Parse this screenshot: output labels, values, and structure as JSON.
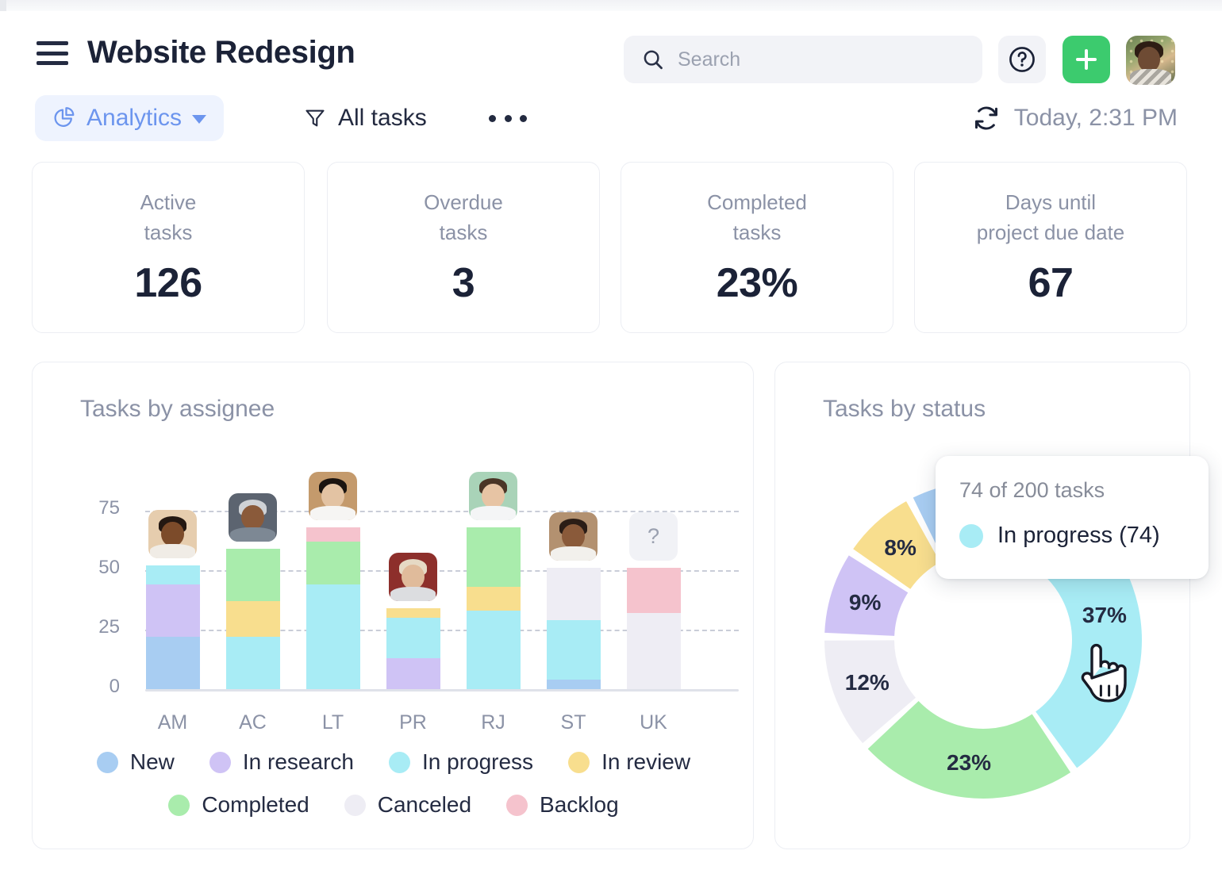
{
  "window": {
    "title": "Website Redesign"
  },
  "header": {
    "menu_icon": "hamburger-icon",
    "title": "Website Redesign",
    "search": {
      "placeholder": "Search",
      "value": "",
      "icon": "search-icon"
    },
    "help_icon": "question-circle-icon",
    "add_icon": "plus-icon",
    "avatar": "user-avatar"
  },
  "toolbar": {
    "view_label": "Analytics",
    "view_icon": "pie-chart-icon",
    "chevron_icon": "chevron-down-icon",
    "filter_label": "All tasks",
    "filter_icon": "funnel-icon",
    "more_icon": "ellipsis-icon",
    "refresh_icon": "refresh-icon",
    "refresh_label": "Today, 2:31 PM"
  },
  "stats": [
    {
      "label": "Active\ntasks",
      "value": "126"
    },
    {
      "label": "Overdue\ntasks",
      "value": "3"
    },
    {
      "label": "Completed\ntasks",
      "value": "23%"
    },
    {
      "label": "Days until\nproject due date",
      "value": "67"
    }
  ],
  "assignee_panel": {
    "title": "Tasks by assignee",
    "avatars": [
      {
        "initials": "AM",
        "known": true
      },
      {
        "initials": "AC",
        "known": true
      },
      {
        "initials": "LT",
        "known": true
      },
      {
        "initials": "PR",
        "known": true
      },
      {
        "initials": "RJ",
        "known": true
      },
      {
        "initials": "ST",
        "known": true
      },
      {
        "initials": "UK",
        "known": false,
        "placeholder": "?"
      }
    ]
  },
  "status_panel": {
    "title": "Tasks by status",
    "tooltip": {
      "headline": "74 of 200 tasks",
      "series_label": "In progress (74)",
      "series_color": "#a8ecf5"
    },
    "cursor_icon": "pointer-hand-cursor"
  },
  "statuses": [
    {
      "name": "New",
      "color": "#a8cdf2"
    },
    {
      "name": "In research",
      "color": "#cfc3f5"
    },
    {
      "name": "In progress",
      "color": "#a8ecf5"
    },
    {
      "name": "In review",
      "color": "#f8de8e"
    },
    {
      "name": "Completed",
      "color": "#a9ecac"
    },
    {
      "name": "Canceled",
      "color": "#eeedf4"
    },
    {
      "name": "Backlog",
      "color": "#f5c3cd"
    }
  ],
  "chart_data": [
    {
      "type": "bar",
      "stacked": true,
      "title": "Tasks by assignee",
      "xlabel": "",
      "ylabel": "",
      "ylim": [
        0,
        80
      ],
      "yticks": [
        0,
        25,
        50,
        75
      ],
      "grid": true,
      "legend_position": "bottom",
      "categories": [
        "AM",
        "AC",
        "LT",
        "PR",
        "RJ",
        "ST",
        "UK"
      ],
      "series": [
        {
          "name": "New",
          "color": "#a8cdf2",
          "values": [
            22,
            0,
            0,
            0,
            0,
            4,
            0
          ]
        },
        {
          "name": "In research",
          "color": "#cfc3f5",
          "values": [
            22,
            0,
            0,
            13,
            0,
            0,
            0
          ]
        },
        {
          "name": "In progress",
          "color": "#a8ecf5",
          "values": [
            8,
            22,
            44,
            17,
            33,
            25,
            0
          ]
        },
        {
          "name": "In review",
          "color": "#f8de8e",
          "values": [
            0,
            15,
            0,
            4,
            10,
            0,
            0
          ]
        },
        {
          "name": "Completed",
          "color": "#a9ecac",
          "values": [
            0,
            22,
            18,
            0,
            25,
            0,
            0
          ]
        },
        {
          "name": "Canceled",
          "color": "#eeedf4",
          "values": [
            0,
            0,
            0,
            0,
            0,
            22,
            32
          ]
        },
        {
          "name": "Backlog",
          "color": "#f5c3cd",
          "values": [
            0,
            0,
            6,
            0,
            0,
            0,
            19
          ]
        }
      ],
      "totals": [
        52,
        59,
        68,
        34,
        68,
        51,
        51
      ]
    },
    {
      "type": "pie",
      "donut": true,
      "title": "Tasks by status",
      "total_tasks": 200,
      "labels": [
        "In progress",
        "Completed",
        "Canceled",
        "In research",
        "In review",
        "New"
      ],
      "values": [
        74,
        46,
        24,
        18,
        16,
        22
      ],
      "percents": [
        "37%",
        "23%",
        "12%",
        "9%",
        "8%",
        ""
      ],
      "colors": [
        "#a8ecf5",
        "#a9ecac",
        "#eeedf4",
        "#cfc3f5",
        "#f8de8e",
        "#a8cdf2"
      ],
      "highlighted": "In progress",
      "legend_position": "none"
    }
  ]
}
